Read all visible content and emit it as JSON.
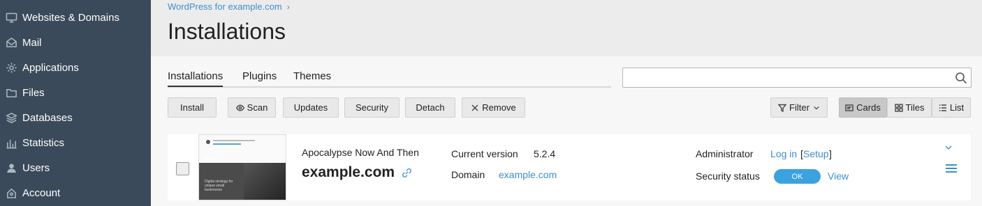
{
  "sidebar": {
    "items": [
      {
        "label": "Websites & Domains",
        "icon": "monitor-icon"
      },
      {
        "label": "Mail",
        "icon": "mail-icon"
      },
      {
        "label": "Applications",
        "icon": "gear-icon"
      },
      {
        "label": "Files",
        "icon": "folder-icon"
      },
      {
        "label": "Databases",
        "icon": "database-icon"
      },
      {
        "label": "Statistics",
        "icon": "bar-chart-icon"
      },
      {
        "label": "Users",
        "icon": "user-icon"
      },
      {
        "label": "Account",
        "icon": "account-icon"
      }
    ]
  },
  "header": {
    "breadcrumb": "WordPress for example.com",
    "title": "Installations"
  },
  "tabs": [
    "Installations",
    "Plugins",
    "Themes"
  ],
  "search": {
    "placeholder": ""
  },
  "toolbar": {
    "install": "Install",
    "scan": "Scan",
    "updates": "Updates",
    "security": "Security",
    "detach": "Detach",
    "remove": "Remove",
    "filter": "Filter"
  },
  "view_modes": {
    "cards": "Cards",
    "tiles": "Tiles",
    "list": "List",
    "active": "Cards"
  },
  "card": {
    "site_name": "Apocalypse Now And Then",
    "domain_title": "example.com",
    "version_label": "Current version",
    "version_value": "5.2.4",
    "domain_label": "Domain",
    "domain_value": "example.com",
    "admin_label": "Administrator",
    "login_link": "Log in",
    "setup_link": "Setup",
    "security_label": "Security status",
    "security_status": "OK",
    "view_link": "View",
    "thumbnail": {
      "welcome": "Welcome",
      "tagline": "Digital strategy for unique small businesses"
    }
  },
  "colors": {
    "sidebar": "#3b4a5a",
    "link": "#3d8fcc",
    "ok_badge": "#3ba2e0"
  }
}
